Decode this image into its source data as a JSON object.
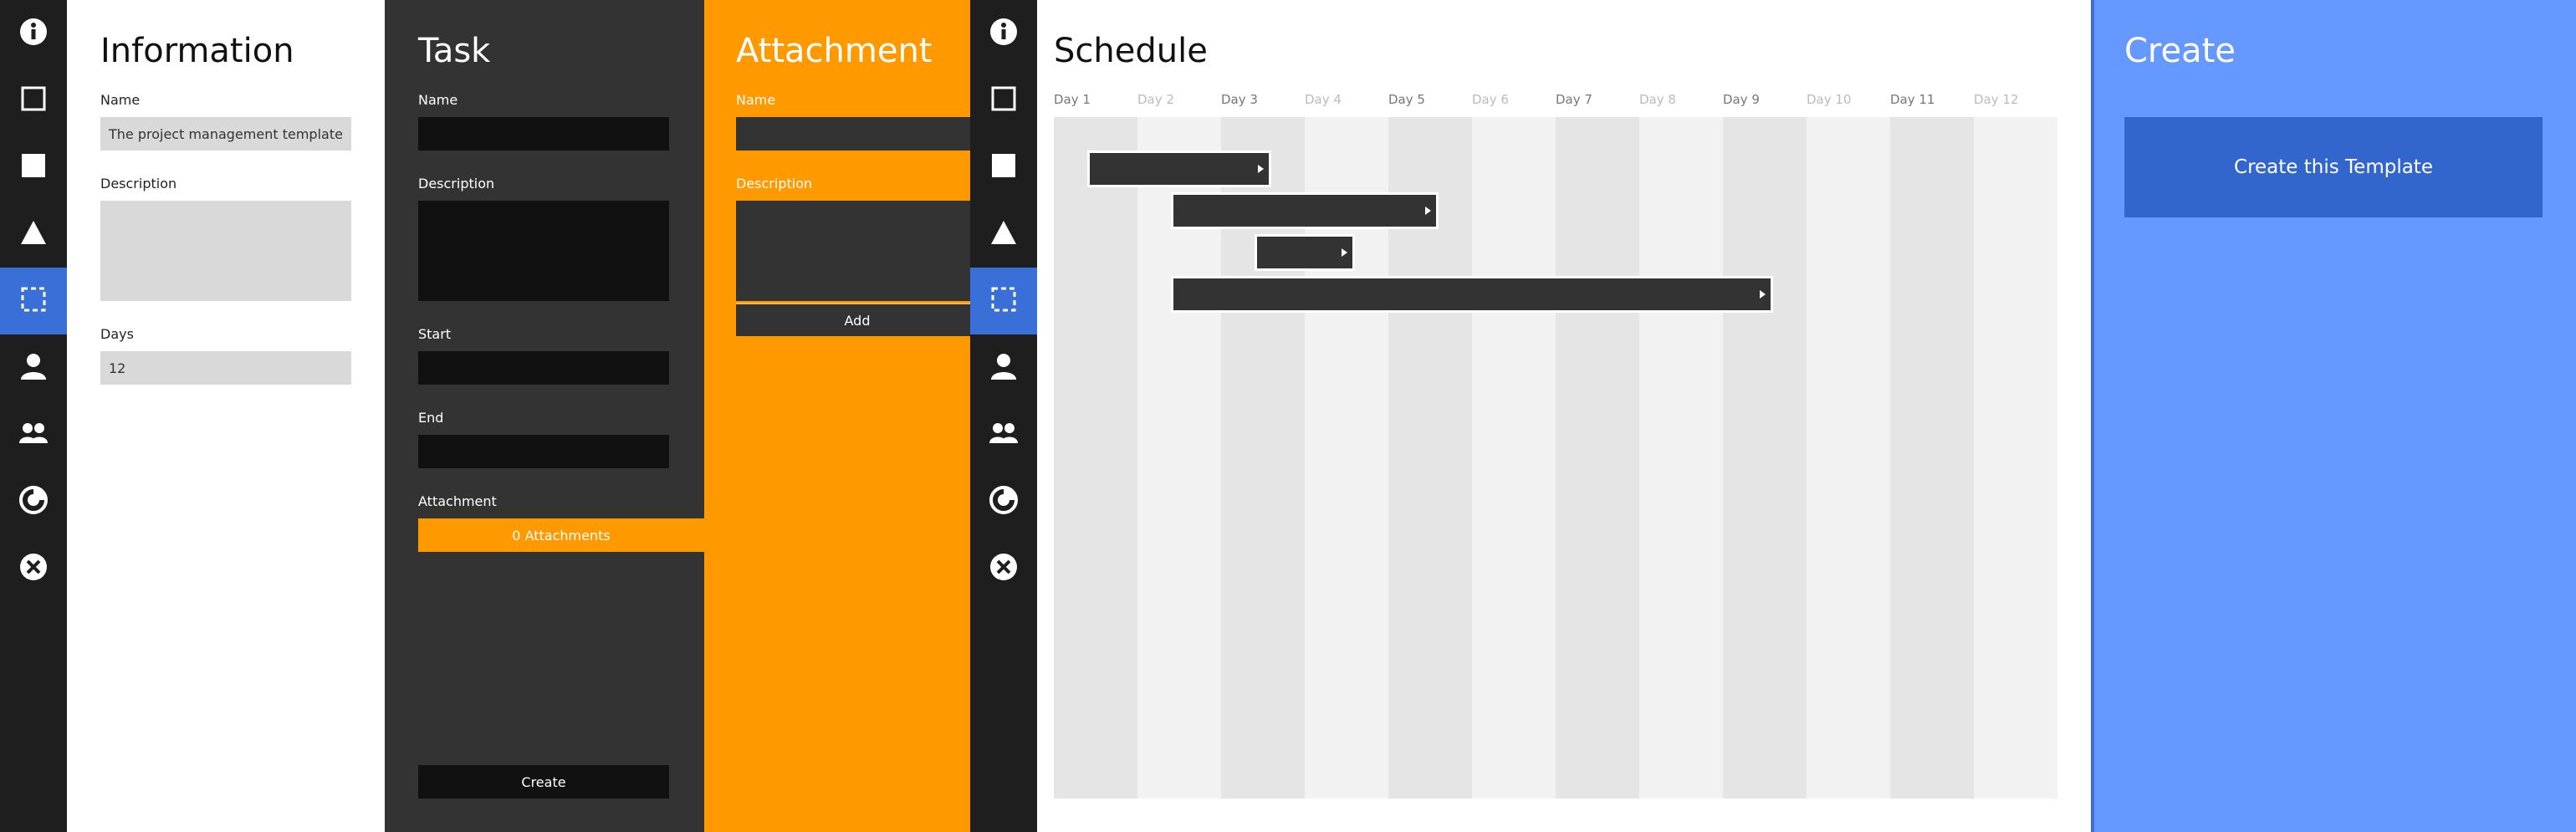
{
  "colors": {
    "rail": "#1e1e1e",
    "rail_active": "#3a6fd8",
    "task_panel": "#333333",
    "attachment_panel": "#ff9900",
    "create_panel": "#6699ff",
    "create_button": "#3366cc"
  },
  "rail_icons": [
    "info-icon",
    "square-outline-icon",
    "square-filled-icon",
    "triangle-icon",
    "dashed-square-icon",
    "person-icon",
    "people-icon",
    "chart-circle-icon",
    "close-circle-icon"
  ],
  "rail_active_index": 4,
  "information": {
    "title": "Information",
    "name_label": "Name",
    "name_value": "The project management template",
    "description_label": "Description",
    "description_value": "",
    "days_label": "Days",
    "days_value": "12"
  },
  "task": {
    "title": "Task",
    "name_label": "Name",
    "description_label": "Description",
    "start_label": "Start",
    "end_label": "End",
    "attachment_label": "Attachment",
    "attachments_button": "0 Attachments",
    "create_button": "Create"
  },
  "attachment": {
    "title": "Attachment",
    "name_label": "Name",
    "description_label": "Description",
    "add_button": "Add"
  },
  "schedule": {
    "title": "Schedule",
    "days": [
      "Day 1",
      "Day 2",
      "Day 3",
      "Day 4",
      "Day 5",
      "Day 6",
      "Day 7",
      "Day 8",
      "Day 9",
      "Day 10",
      "Day 11",
      "Day 12"
    ],
    "tasks": [
      {
        "start": 1.4,
        "end": 3.6
      },
      {
        "start": 2.4,
        "end": 5.6
      },
      {
        "start": 3.4,
        "end": 4.6
      },
      {
        "start": 2.4,
        "end": 9.6
      }
    ]
  },
  "create": {
    "title": "Create",
    "button": "Create this Template"
  }
}
